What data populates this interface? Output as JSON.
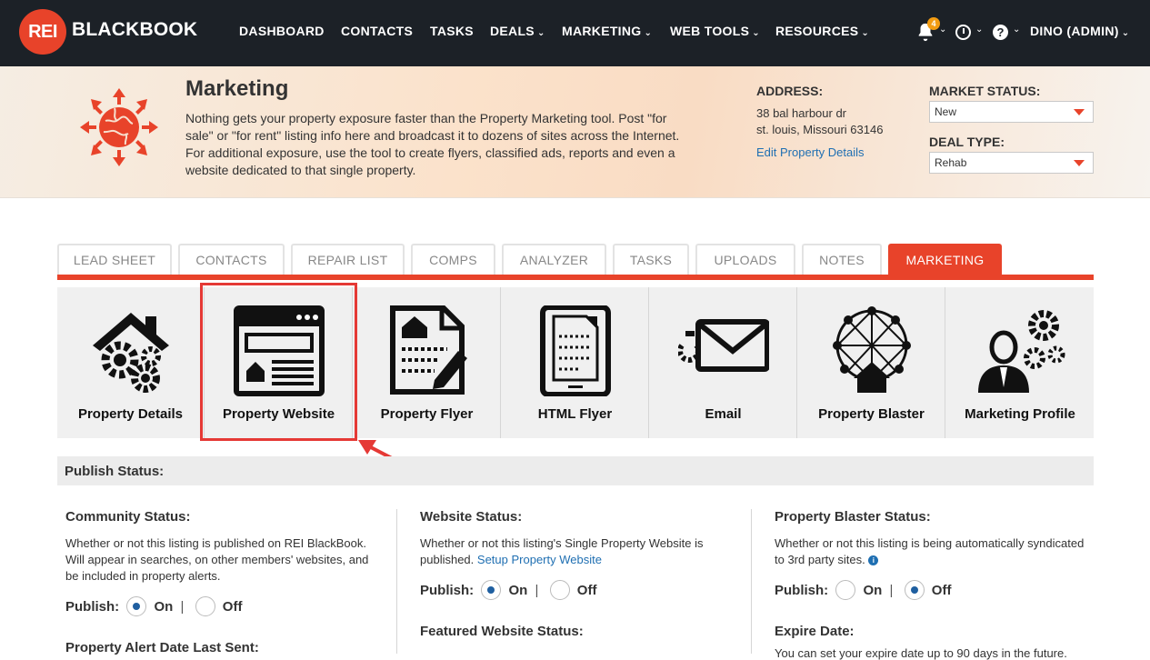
{
  "app": {
    "logo_mark": "REI",
    "logo_text": "BLACKBOOK",
    "brand_color": "#e8432a",
    "nav_bg": "#1c2127"
  },
  "nav": {
    "items": [
      {
        "label": "DASHBOARD",
        "dropdown": false
      },
      {
        "label": "CONTACTS",
        "dropdown": false
      },
      {
        "label": "TASKS",
        "dropdown": false
      },
      {
        "label": "DEALS",
        "dropdown": true
      },
      {
        "label": "MARKETING",
        "dropdown": true
      },
      {
        "label": "WEB TOOLS",
        "dropdown": true
      },
      {
        "label": "RESOURCES",
        "dropdown": true
      }
    ],
    "notification_count": "4",
    "user": "DINO (ADMIN)",
    "help_glyph": "?",
    "chevron": "⌄"
  },
  "header": {
    "title": "Marketing",
    "description": "Nothing gets your property exposure faster than the Property Marketing tool. Post \"for sale\" or \"for rent\" listing info here and broadcast it to dozens of sites across the Internet. For additional exposure, use the tool to create flyers, classified ads, reports and even a website dedicated to that single property.",
    "address_label": "ADDRESS:",
    "address_line1": "38 bal harbour dr",
    "address_line2": "st. louis, Missouri 63146",
    "edit_link": "Edit Property Details",
    "market_status_label": "MARKET STATUS:",
    "market_status_value": "New",
    "deal_type_label": "DEAL TYPE:",
    "deal_type_value": "Rehab"
  },
  "tabs": [
    {
      "label": "LEAD SHEET",
      "active": false
    },
    {
      "label": "CONTACTS",
      "active": false
    },
    {
      "label": "REPAIR LIST",
      "active": false
    },
    {
      "label": "COMPS",
      "active": false
    },
    {
      "label": "ANALYZER",
      "active": false
    },
    {
      "label": "TASKS",
      "active": false
    },
    {
      "label": "UPLOADS",
      "active": false
    },
    {
      "label": "NOTES",
      "active": false
    },
    {
      "label": "MARKETING",
      "active": true
    }
  ],
  "tools": [
    {
      "label": "Property Details",
      "icon": "house-gears-icon"
    },
    {
      "label": "Property Website",
      "icon": "website-window-icon",
      "highlighted": true
    },
    {
      "label": "Property Flyer",
      "icon": "flyer-document-icon"
    },
    {
      "label": "HTML Flyer",
      "icon": "tablet-document-icon"
    },
    {
      "label": "Email",
      "icon": "envelope-icon"
    },
    {
      "label": "Property Blaster",
      "icon": "network-house-icon"
    },
    {
      "label": "Marketing Profile",
      "icon": "person-gears-icon"
    }
  ],
  "publish": {
    "heading": "Publish Status:",
    "community": {
      "title": "Community Status:",
      "text": "Whether or not this listing is published on REI BlackBook. Will appear in searches, on other members' websites, and be included in property alerts.",
      "publish_label": "Publish:",
      "on_label": "On",
      "off_label": "Off",
      "value": "on",
      "next_title": "Property Alert Date Last Sent:"
    },
    "website": {
      "title": "Website Status:",
      "text": "Whether or not this listing's Single Property Website is published.",
      "link": "Setup Property Website",
      "publish_label": "Publish:",
      "on_label": "On",
      "off_label": "Off",
      "value": "on",
      "next_title": "Featured Website Status:"
    },
    "blaster": {
      "title": "Property Blaster Status:",
      "text": "Whether or not this listing is being automatically syndicated to 3rd party sites.",
      "info_glyph": "i",
      "publish_label": "Publish:",
      "on_label": "On",
      "off_label": "Off",
      "value": "off",
      "next_title": "Expire Date:",
      "next_text": "You can set your expire date up to 90 days in the future."
    }
  }
}
